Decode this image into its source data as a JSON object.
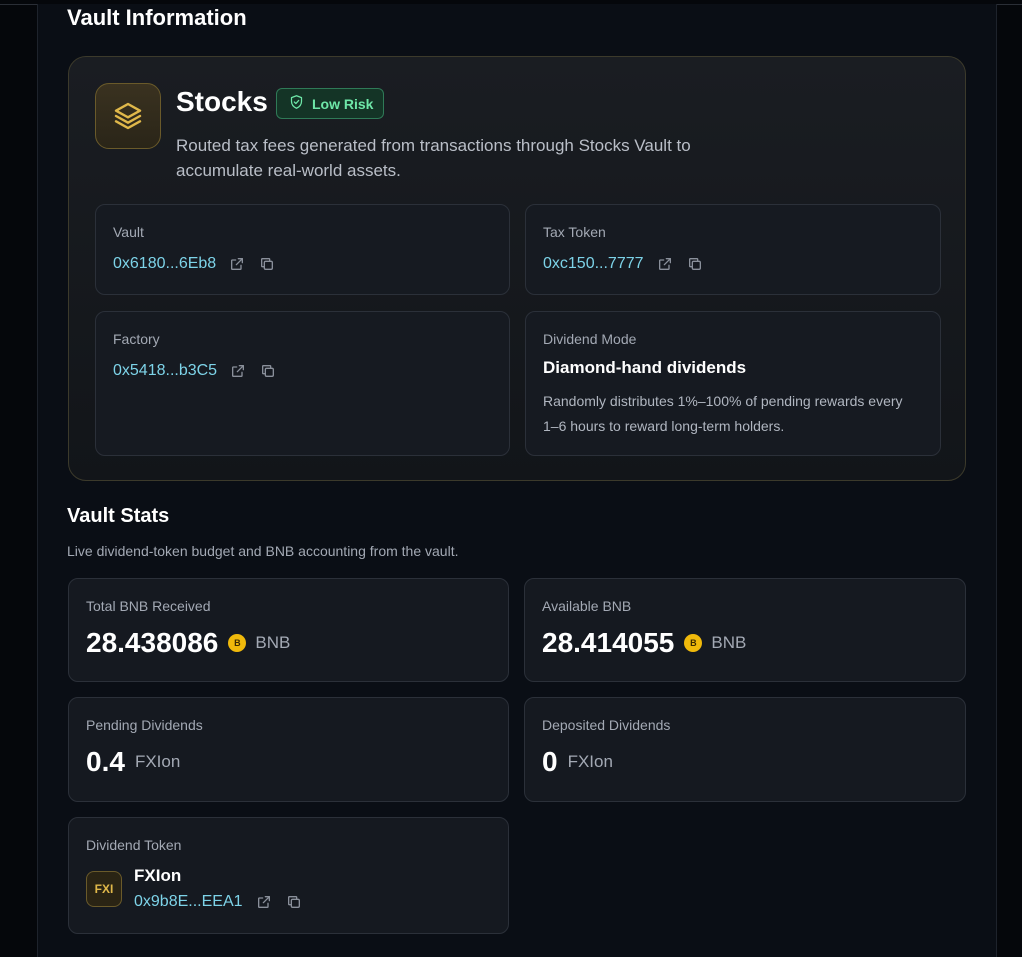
{
  "vault_information": {
    "title": "Vault Information",
    "vault": {
      "name": "Stocks",
      "risk_badge": "Low Risk",
      "description": "Routed tax fees generated from transactions through Stocks Vault to accumulate real-world assets."
    },
    "fields": {
      "vault": {
        "label": "Vault",
        "address": "0x6180...6Eb8"
      },
      "tax_token": {
        "label": "Tax Token",
        "address": "0xc150...7777"
      },
      "factory": {
        "label": "Factory",
        "address": "0x5418...b3C5"
      },
      "dividend_mode": {
        "label": "Dividend Mode",
        "title": "Diamond-hand dividends",
        "description": "Randomly distributes 1%–100% of pending rewards every 1–6 hours to reward long-term holders."
      }
    }
  },
  "vault_stats": {
    "title": "Vault Stats",
    "description": "Live dividend-token budget and BNB accounting from the vault.",
    "total_bnb_received": {
      "label": "Total BNB Received",
      "value": "28.438086",
      "unit": "BNB"
    },
    "available_bnb": {
      "label": "Available BNB",
      "value": "28.414055",
      "unit": "BNB"
    },
    "pending_dividends": {
      "label": "Pending Dividends",
      "value": "0.4",
      "unit": "FXIon"
    },
    "deposited_dividends": {
      "label": "Deposited Dividends",
      "value": "0",
      "unit": "FXIon"
    },
    "dividend_token": {
      "label": "Dividend Token",
      "badge": "FXI",
      "name": "FXIon",
      "address": "0x9b8E...EEA1"
    }
  },
  "icons": {
    "vault_icon": "layers-icon",
    "risk_icon": "shield-check-icon",
    "open_link": "external-link-icon",
    "copy": "copy-icon",
    "coin": "bnb-coin-icon",
    "coin_glyph": "B"
  },
  "colors": {
    "background": "#05070b",
    "panel": "#0a0e15",
    "accent_gold": "#e0b84a",
    "address_link": "#7dd3e8",
    "risk_green": "#6ee7a8",
    "bnb_yellow": "#f0b90b"
  }
}
